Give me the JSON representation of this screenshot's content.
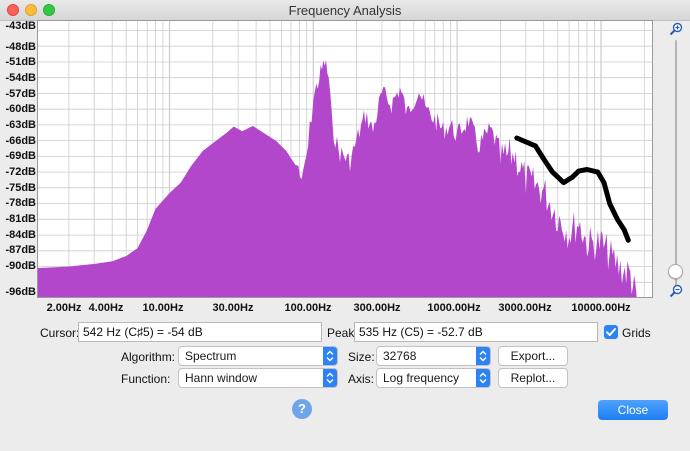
{
  "window": {
    "title": "Frequency Analysis"
  },
  "chart_data": {
    "type": "area",
    "x_scale": "log",
    "xlim": [
      1.2,
      23000
    ],
    "ylim": [
      -96,
      -43
    ],
    "y_ticks": [
      "-43dB",
      "-48dB",
      "-51dB",
      "-54dB",
      "-57dB",
      "-60dB",
      "-63dB",
      "-66dB",
      "-69dB",
      "-72dB",
      "-75dB",
      "-78dB",
      "-81dB",
      "-84dB",
      "-87dB",
      "-90dB",
      "-96dB"
    ],
    "x_ticks": [
      "2.00Hz",
      "4.00Hz",
      "10.00Hz",
      "30.00Hz",
      "100.00Hz",
      "300.00Hz",
      "1000.00Hz",
      "3000.00Hz",
      "10000.00Hz"
    ],
    "grid": true,
    "fill_color": "#b347cc",
    "grid_color": "#cccccc",
    "spectrum": [
      [
        1.2,
        -90.3
      ],
      [
        2,
        -90
      ],
      [
        3,
        -89.5
      ],
      [
        4,
        -89
      ],
      [
        5,
        -88
      ],
      [
        6,
        -86.5
      ],
      [
        7,
        -83
      ],
      [
        8,
        -79
      ],
      [
        10,
        -76
      ],
      [
        12,
        -74
      ],
      [
        14,
        -71
      ],
      [
        17,
        -68
      ],
      [
        20,
        -66.5
      ],
      [
        25,
        -64.5
      ],
      [
        28,
        -63.3
      ],
      [
        32,
        -64.2
      ],
      [
        38,
        -63.2
      ],
      [
        45,
        -64.5
      ],
      [
        55,
        -66
      ],
      [
        65,
        -68
      ],
      [
        75,
        -70.6
      ],
      [
        85,
        -71.2
      ],
      [
        92,
        -65
      ],
      [
        100,
        -56
      ],
      [
        110,
        -52
      ],
      [
        120,
        -49
      ],
      [
        128,
        -52
      ],
      [
        135,
        -61
      ],
      [
        150,
        -66
      ],
      [
        180,
        -68
      ],
      [
        200,
        -64
      ],
      [
        230,
        -59
      ],
      [
        260,
        -62
      ],
      [
        300,
        -55
      ],
      [
        350,
        -57
      ],
      [
        400,
        -54
      ],
      [
        450,
        -59
      ],
      [
        500,
        -56
      ],
      [
        542,
        -54
      ],
      [
        600,
        -58
      ],
      [
        700,
        -60
      ],
      [
        800,
        -62
      ],
      [
        900,
        -61
      ],
      [
        1000,
        -63
      ],
      [
        1200,
        -60
      ],
      [
        1400,
        -65
      ],
      [
        1700,
        -62
      ],
      [
        2000,
        -66
      ],
      [
        2500,
        -65
      ],
      [
        3000,
        -70
      ],
      [
        4000,
        -72
      ],
      [
        5000,
        -77
      ],
      [
        6000,
        -80
      ],
      [
        7000,
        -78
      ],
      [
        8000,
        -82
      ],
      [
        10000,
        -82
      ],
      [
        12000,
        -85
      ],
      [
        14000,
        -87
      ],
      [
        16000,
        -88
      ],
      [
        17000,
        -91
      ],
      [
        18500,
        -96
      ],
      [
        20000,
        -96
      ]
    ],
    "drawn_stroke": [
      [
        2600,
        -65.5
      ],
      [
        3500,
        -67
      ],
      [
        4000,
        -69.5
      ],
      [
        4600,
        -72
      ],
      [
        5500,
        -74
      ],
      [
        6300,
        -73
      ],
      [
        7000,
        -71.8
      ],
      [
        8000,
        -71.5
      ],
      [
        9500,
        -72
      ],
      [
        10500,
        -74
      ],
      [
        11500,
        -78
      ],
      [
        13000,
        -81
      ],
      [
        14500,
        -83
      ],
      [
        15500,
        -85
      ]
    ]
  },
  "controls": {
    "cursor_label": "Cursor:",
    "cursor_value": "542 Hz (C♯5) = -54 dB",
    "peak_label": "Peak:",
    "peak_value": "535 Hz (C5) = -52.7 dB",
    "grids_label": "Grids",
    "algorithm_label": "Algorithm:",
    "algorithm_value": "Spectrum",
    "size_label": "Size:",
    "size_value": "32768",
    "export_label": "Export...",
    "function_label": "Function:",
    "function_value": "Hann window",
    "axis_label": "Axis:",
    "axis_value": "Log frequency",
    "replot_label": "Replot...",
    "help_label": "?",
    "close_label": "Close"
  },
  "icons": {
    "zoom_in": "zoom-in-icon",
    "zoom_out": "zoom-out-icon"
  }
}
